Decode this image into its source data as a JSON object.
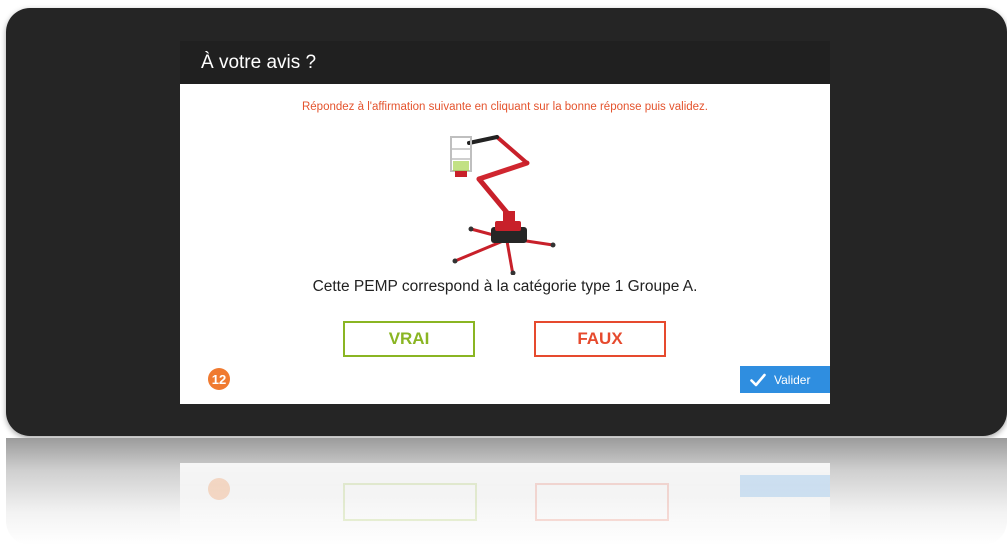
{
  "dialog": {
    "title": "À votre avis ?",
    "instruction": "Répondez à l'affirmation suivante en cliquant sur la bonne réponse puis validez.",
    "statement": "Cette PEMP correspond à la catégorie type 1 Groupe A.",
    "image_subject": "mobile elevating work platform (spider lift)"
  },
  "answers": {
    "true_label": "VRAI",
    "false_label": "FAUX"
  },
  "footer": {
    "question_number": "12",
    "validate_label": "Valider"
  },
  "colors": {
    "device_bezel": "#252525",
    "title_bar": "#202020",
    "instruction_text": "#e4532d",
    "true_accent": "#8ab523",
    "false_accent": "#e64a2e",
    "badge": "#f07a30",
    "validate_button": "#2f8ee0"
  },
  "icons": {
    "validate": "check-icon"
  }
}
